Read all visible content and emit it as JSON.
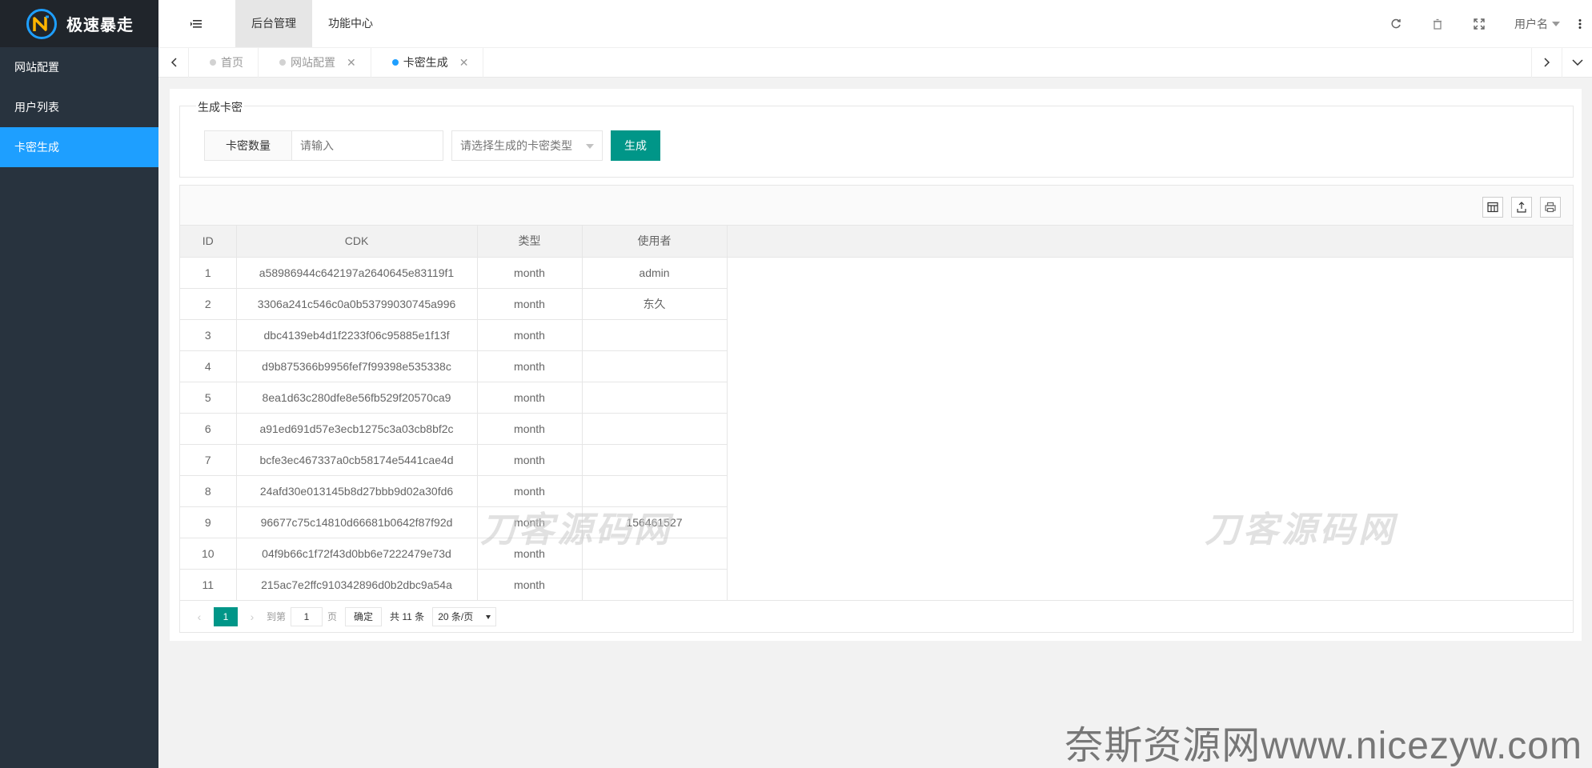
{
  "brand": {
    "name": "极速暴走"
  },
  "sidebar": {
    "items": [
      {
        "label": "网站配置"
      },
      {
        "label": "用户列表"
      },
      {
        "label": "卡密生成"
      }
    ]
  },
  "header": {
    "tabs": [
      {
        "label": "后台管理"
      },
      {
        "label": "功能中心"
      }
    ],
    "user": "用户名"
  },
  "page_tabs": [
    {
      "label": "首页"
    },
    {
      "label": "网站配置"
    },
    {
      "label": "卡密生成"
    }
  ],
  "form": {
    "legend": "生成卡密",
    "count_label": "卡密数量",
    "count_placeholder": "请输入",
    "type_placeholder": "请选择生成的卡密类型",
    "submit": "生成"
  },
  "table": {
    "columns": [
      "ID",
      "CDK",
      "类型",
      "使用者"
    ],
    "rows": [
      [
        "1",
        "a58986944c642197a2640645e83119f1",
        "month",
        "admin"
      ],
      [
        "2",
        "3306a241c546c0a0b53799030745a996",
        "month",
        "东久"
      ],
      [
        "3",
        "dbc4139eb4d1f2233f06c95885e1f13f",
        "month",
        ""
      ],
      [
        "4",
        "d9b875366b9956fef7f99398e535338c",
        "month",
        ""
      ],
      [
        "5",
        "8ea1d63c280dfe8e56fb529f20570ca9",
        "month",
        ""
      ],
      [
        "6",
        "a91ed691d57e3ecb1275c3a03cb8bf2c",
        "month",
        ""
      ],
      [
        "7",
        "bcfe3ec467337a0cb58174e5441cae4d",
        "month",
        ""
      ],
      [
        "8",
        "24afd30e013145b8d27bbb9d02a30fd6",
        "month",
        ""
      ],
      [
        "9",
        "96677c75c14810d66681b0642f87f92d",
        "month",
        "156461527"
      ],
      [
        "10",
        "04f9b66c1f72f43d0bb6e7222479e73d",
        "month",
        ""
      ],
      [
        "11",
        "215ac7e2ffc910342896d0b2dbc9a54a",
        "month",
        ""
      ]
    ]
  },
  "pager": {
    "current": "1",
    "goto_label": "到第",
    "page_value": "1",
    "page_suffix": "页",
    "confirm": "确定",
    "total": "共 11 条",
    "page_size": "20 条/页"
  },
  "watermarks": {
    "center": "刀客源码网",
    "right": "刀客源码网",
    "site": "奈斯资源网www.nicezyw.com"
  },
  "colors": {
    "sidebar": "#28333e",
    "active": "#1e9fff",
    "primary": "#009688"
  }
}
